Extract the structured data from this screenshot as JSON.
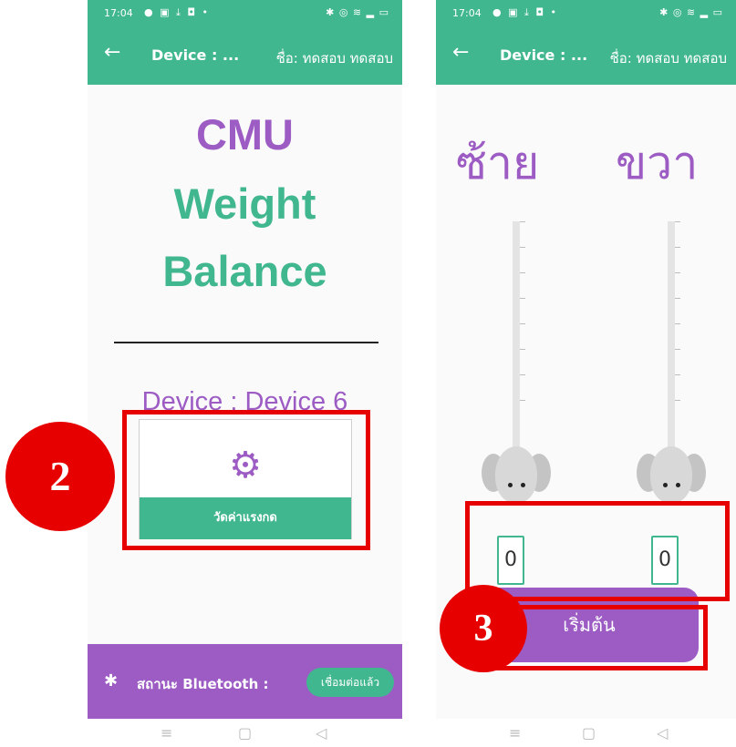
{
  "status_bar": {
    "time": "17:04",
    "left_icons": "● ▣ ⤓ ◘ •",
    "right_icons": "✱ ◎ ≋ ▂ ▭"
  },
  "app_bar": {
    "back_icon": "←",
    "device_title": "Device : ...",
    "user_name": "ชื่อ: ทดสอบ ทดสอบ"
  },
  "nav_bar": {
    "recent": "≡",
    "home": "▢",
    "back": "◁"
  },
  "home": {
    "title_lines": [
      "CMU",
      "Weight",
      "Balance"
    ],
    "device_label": "Device : Device 6",
    "measure_button_label": "วัดค่าแรงกด",
    "gear_icon": "⚙",
    "bluetooth_icon": "✱",
    "bluetooth_label": "สถานะ Bluetooth :",
    "bluetooth_status": "เชื่อมต่อแล้ว"
  },
  "measure": {
    "left_label": "ซ้าย",
    "right_label": "ขวา",
    "left_value": "0",
    "right_value": "0",
    "start_button_label": "เริ่มต้น"
  },
  "annotations": {
    "badge_2": "2",
    "badge_3": "3"
  },
  "colors": {
    "primary_green": "#41b78f",
    "primary_purple": "#9c5cc4",
    "highlight_red": "#e60000"
  }
}
